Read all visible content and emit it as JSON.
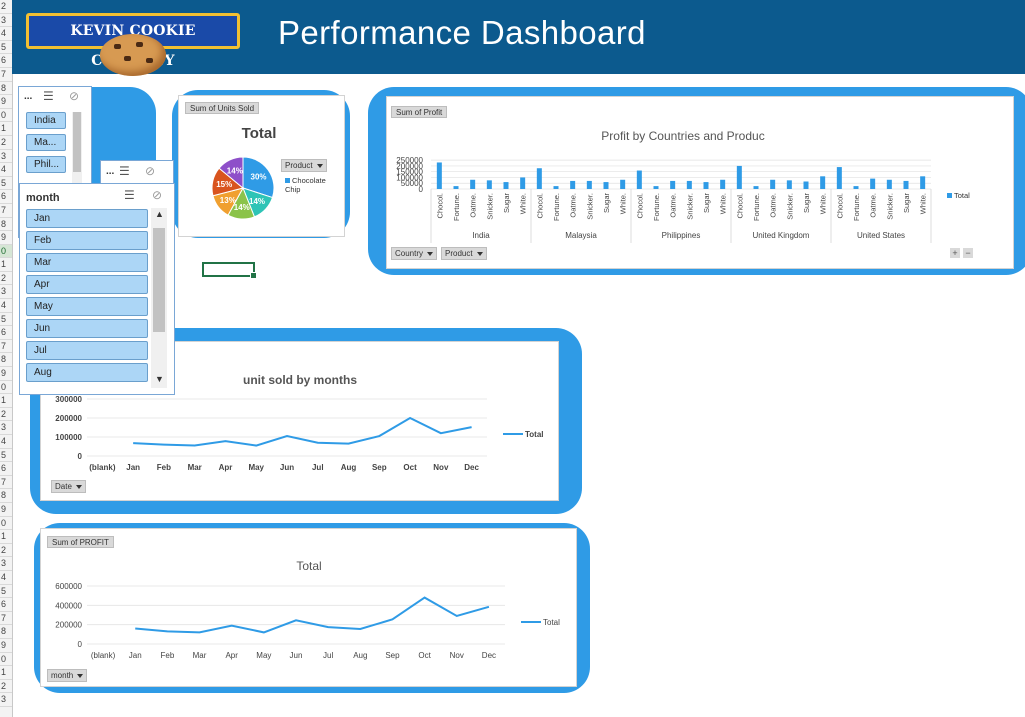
{
  "header": {
    "logo_text": "KEVIN COOKIE COMPANY",
    "title": "Performance Dashboard",
    "colors": {
      "banner": "#0c5a8e",
      "accent": "#2f9be6"
    }
  },
  "rows": [
    "2",
    "3",
    "4",
    "5",
    "6",
    "7",
    "8",
    "9",
    "0",
    "1",
    "2",
    "3",
    "4",
    "5",
    "6",
    "7",
    "8",
    "9",
    "0",
    "1",
    "2",
    "3",
    "4",
    "5",
    "6",
    "7",
    "8",
    "9",
    "0",
    "1",
    "2",
    "3",
    "4",
    "5",
    "6",
    "7",
    "8",
    "9",
    "0",
    "1",
    "2",
    "3",
    "4",
    "5",
    "6",
    "7",
    "8",
    "9",
    "0",
    "1",
    "2",
    "3"
  ],
  "country_slicer": {
    "header": "...",
    "items": [
      "India",
      "Ma...",
      "Phil..."
    ]
  },
  "product_slicer": {
    "header": "..."
  },
  "month_slicer": {
    "header": "month",
    "items": [
      "Jan",
      "Feb",
      "Mar",
      "Apr",
      "May",
      "Jun",
      "Jul",
      "Aug"
    ]
  },
  "pie_card": {
    "field_button": "Sum of Units Sold",
    "filter_button": "Product",
    "legend_label": "Chocolate Chip"
  },
  "profit_country_card": {
    "field_button": "Sum of Profit",
    "buttons": [
      "Country",
      "Product"
    ],
    "legend_label": "Total"
  },
  "units_month_card": {
    "filter_button": "Date",
    "legend_label": "Total"
  },
  "profit_month_card": {
    "field_button": "Sum of PROFIT",
    "filter_button": "month",
    "legend_label": "Total"
  },
  "chart_data": [
    {
      "type": "pie",
      "title": "Total",
      "series": [
        {
          "values": [
            30,
            14,
            14,
            13,
            15,
            14
          ]
        }
      ],
      "labels": [
        "30%",
        "14%",
        "14%",
        "13%",
        "15%",
        "14%"
      ],
      "colors": [
        "#2f9be6",
        "#2ec4b6",
        "#8bc34a",
        "#f0a030",
        "#d9541e",
        "#8e4fc9"
      ]
    },
    {
      "type": "bar",
      "title": "Profit by Countries and Produc",
      "groups": [
        "India",
        "Malaysia",
        "Philippines",
        "United Kingdom",
        "United States"
      ],
      "categories": [
        "Chocol.",
        "Fortune.",
        "Oatme.",
        "Snicker.",
        "Sugar",
        "White."
      ],
      "series": [
        {
          "values": [
            [
              230000,
              25000,
              80000,
              75000,
              60000,
              100000
            ],
            [
              180000,
              25000,
              70000,
              70000,
              60000,
              80000
            ],
            [
              160000,
              25000,
              70000,
              70000,
              60000,
              80000
            ],
            [
              200000,
              25000,
              80000,
              75000,
              65000,
              110000
            ],
            [
              190000,
              25000,
              90000,
              80000,
              70000,
              110000
            ]
          ]
        }
      ],
      "yticks": [
        "0",
        "50000",
        "100000",
        "150000",
        "200000",
        "250000"
      ],
      "ylim": [
        0,
        260000
      ]
    },
    {
      "type": "line",
      "title": "unit sold by months",
      "categories": [
        "(blank)",
        "Jan",
        "Feb",
        "Mar",
        "Apr",
        "May",
        "Jun",
        "Jul",
        "Aug",
        "Sep",
        "Oct",
        "Nov",
        "Dec"
      ],
      "series": [
        {
          "name": "Total",
          "values": [
            null,
            68000,
            60000,
            55000,
            78000,
            55000,
            105000,
            70000,
            65000,
            105000,
            200000,
            120000,
            152000
          ]
        }
      ],
      "yticks": [
        "0",
        "100000",
        "200000",
        "300000"
      ],
      "ylim": [
        0,
        300000
      ]
    },
    {
      "type": "line",
      "title": "Total",
      "categories": [
        "(blank)",
        "Jan",
        "Feb",
        "Mar",
        "Apr",
        "May",
        "Jun",
        "Jul",
        "Aug",
        "Sep",
        "Oct",
        "Nov",
        "Dec"
      ],
      "series": [
        {
          "name": "Total",
          "values": [
            null,
            160000,
            130000,
            120000,
            190000,
            120000,
            245000,
            175000,
            155000,
            255000,
            480000,
            290000,
            385000
          ]
        }
      ],
      "yticks": [
        "0",
        "200000",
        "400000",
        "600000"
      ],
      "ylim": [
        0,
        600000
      ]
    }
  ]
}
